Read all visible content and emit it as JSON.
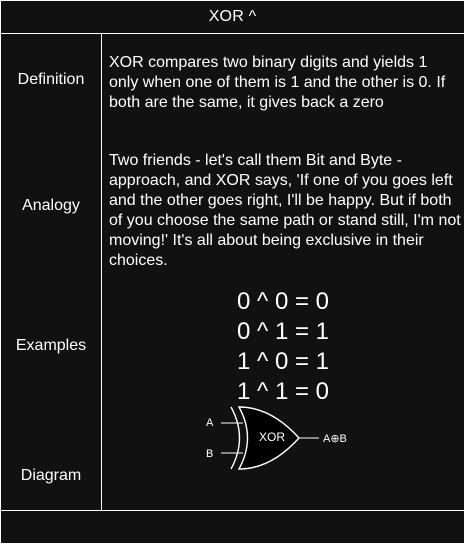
{
  "title": "XOR ^",
  "rows": {
    "definition": {
      "label": "Definition",
      "text": "XOR compares two binary digits and yields 1 only when one of them is 1 and the other is 0. If both are the same, it gives back a zero"
    },
    "analogy": {
      "label": "Analogy",
      "text": "Two friends - let's call them Bit and Byte - approach, and XOR says, 'If one of you goes left and the other goes right, I'll be happy. But if both of you choose the same path or stand still, I'm not moving!' It's all about being exclusive in their choices."
    },
    "examples": {
      "label": "Examples",
      "lines": [
        "0 ^ 0 = 0",
        "0 ^ 1 = 1",
        "1 ^ 0 = 1",
        "1 ^ 1 = 0"
      ]
    },
    "diagram": {
      "label": "Diagram",
      "gate_text": "XOR",
      "input_a": "A",
      "input_b": "B",
      "output": "A⊕B"
    }
  },
  "colors": {
    "background": "#111111",
    "border": "#ffffff",
    "text": "#ffffff"
  }
}
